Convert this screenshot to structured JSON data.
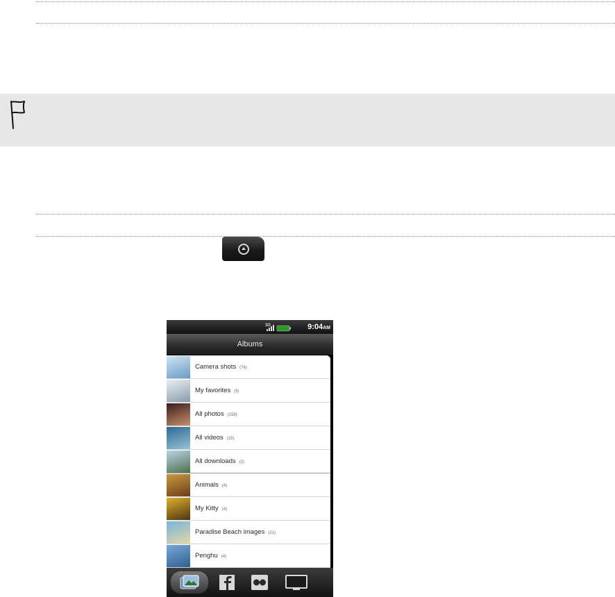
{
  "page": {
    "note_icon": "flag-icon",
    "home_key_icon": "home-key-icon"
  },
  "phone": {
    "status": {
      "network": "3G",
      "time": "9:04",
      "ampm": "AM",
      "icons": [
        "network-3g-icon",
        "signal-icon",
        "battery-icon"
      ]
    },
    "title": "Albums",
    "albums": [
      {
        "name": "Camera shots",
        "count": "(76)",
        "thumb_colors": [
          "#cfe3f1",
          "#6b9bc6"
        ]
      },
      {
        "name": "My favorites",
        "count": "(5)",
        "thumb_colors": [
          "#e9eef4",
          "#8a9cab"
        ]
      },
      {
        "name": "All photos",
        "count": "(159)",
        "thumb_colors": [
          "#3a1d1d",
          "#c98f6c"
        ]
      },
      {
        "name": "All videos",
        "count": "(15)",
        "thumb_colors": [
          "#2a6a93",
          "#9cc1d6"
        ]
      },
      {
        "name": "All downloads",
        "count": "(2)",
        "thumb_colors": [
          "#bcd3e6",
          "#4f6f4c"
        ]
      },
      {
        "name": "Animals",
        "count": "(4)",
        "thumb_colors": [
          "#c99a3e",
          "#6e3d1a"
        ]
      },
      {
        "name": "My Kitty",
        "count": "(4)",
        "thumb_colors": [
          "#e0b02e",
          "#4d3410"
        ]
      },
      {
        "name": "Paradise Beach images",
        "count": "(21)",
        "thumb_colors": [
          "#78b3db",
          "#e4d6a8"
        ]
      },
      {
        "name": "Penghu",
        "count": "(4)",
        "thumb_colors": [
          "#77a9d9",
          "#2f5f8f"
        ]
      }
    ],
    "tabs": [
      {
        "icon": "albums-icon",
        "active": true
      },
      {
        "icon": "facebook-icon",
        "active": false
      },
      {
        "icon": "flickr-icon",
        "active": false
      },
      {
        "icon": "tv-icon",
        "active": false
      }
    ]
  }
}
